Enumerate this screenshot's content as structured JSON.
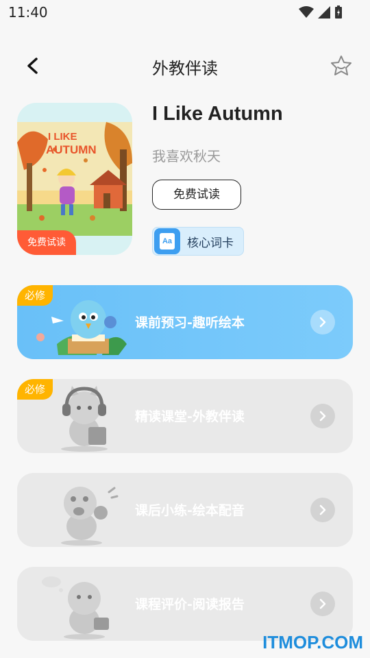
{
  "status": {
    "time": "11:40"
  },
  "header": {
    "title": "外教伴读"
  },
  "book": {
    "title": "I Like Autumn",
    "subtitle": "我喜欢秋天",
    "cover_title_line1": "I LIKE",
    "cover_title_line2": "AUTUMN",
    "free_tag": "免费试读",
    "trial_button": "免费试读",
    "vocab_button": "核心词卡",
    "vocab_icon_text": "Aa"
  },
  "lessons": [
    {
      "label": "课前预习-趣听绘本",
      "badge": "必修",
      "active": true
    },
    {
      "label": "精读课堂-外教伴读",
      "badge": "必修",
      "active": false
    },
    {
      "label": "课后小练-绘本配音",
      "badge": "",
      "active": false
    },
    {
      "label": "课程评价-阅读报告",
      "badge": "",
      "active": false
    }
  ],
  "watermark": "ITMOP.COM",
  "colors": {
    "accent": "#69c0f8",
    "badge": "#ffb400",
    "free_tag": "#ff5b36"
  }
}
